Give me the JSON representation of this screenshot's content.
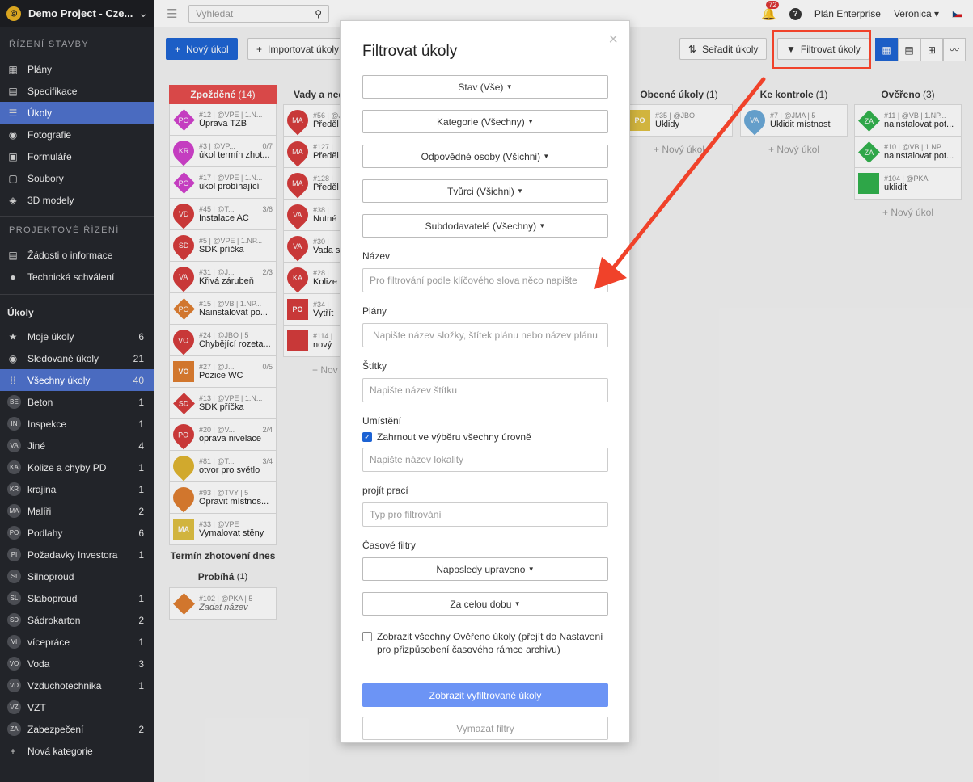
{
  "sidebar": {
    "project": "Demo Project - Cze...",
    "section_build": "ŘÍZENÍ STAVBY",
    "build_items": [
      {
        "label": "Plány",
        "icon": "plans-icon",
        "glyph": "▦"
      },
      {
        "label": "Specifikace",
        "icon": "spec-icon",
        "glyph": "▤"
      },
      {
        "label": "Úkoly",
        "icon": "tasks-icon",
        "glyph": "☰"
      },
      {
        "label": "Fotografie",
        "icon": "camera-icon",
        "glyph": "◉"
      },
      {
        "label": "Formuláře",
        "icon": "forms-icon",
        "glyph": "▣"
      },
      {
        "label": "Soubory",
        "icon": "files-icon",
        "glyph": "▢"
      },
      {
        "label": "3D modely",
        "icon": "cube-icon",
        "glyph": "◈"
      }
    ],
    "section_project": "PROJEKTOVÉ ŘÍZENÍ",
    "project_items": [
      {
        "label": "Žádosti o informace",
        "icon": "info-request-icon",
        "glyph": "▤"
      },
      {
        "label": "Technická schválení",
        "icon": "user-icon",
        "glyph": "●"
      }
    ],
    "tasks_header": "Úkoly",
    "task_filters": [
      {
        "label": "Moje úkoly",
        "count": "6",
        "icon": "star-icon",
        "glyph": "★"
      },
      {
        "label": "Sledované úkoly",
        "count": "21",
        "icon": "eye-icon",
        "glyph": "◉"
      },
      {
        "label": "Všechny úkoly",
        "count": "40",
        "icon": "grid-icon",
        "glyph": "⁞⁞"
      }
    ],
    "categories": [
      {
        "abbr": "BE",
        "label": "Beton",
        "count": "1"
      },
      {
        "abbr": "IN",
        "label": "Inspekce",
        "count": "1"
      },
      {
        "abbr": "VA",
        "label": "Jiné",
        "count": "4"
      },
      {
        "abbr": "KA",
        "label": "Kolize a chyby PD",
        "count": "1"
      },
      {
        "abbr": "KR",
        "label": "krajina",
        "count": "1"
      },
      {
        "abbr": "MA",
        "label": "Malíři",
        "count": "2"
      },
      {
        "abbr": "PO",
        "label": "Podlahy",
        "count": "6"
      },
      {
        "abbr": "PI",
        "label": "Požadavky Investora",
        "count": "1"
      },
      {
        "abbr": "SI",
        "label": "Silnoproud",
        "count": ""
      },
      {
        "abbr": "SL",
        "label": "Slaboproud",
        "count": "1"
      },
      {
        "abbr": "SD",
        "label": "Sádrokarton",
        "count": "2"
      },
      {
        "abbr": "VI",
        "label": "vícepráce",
        "count": "1"
      },
      {
        "abbr": "VO",
        "label": "Voda",
        "count": "3"
      },
      {
        "abbr": "VD",
        "label": "Vzduchotechnika",
        "count": "1"
      },
      {
        "abbr": "VZ",
        "label": "VZT",
        "count": ""
      },
      {
        "abbr": "ZA",
        "label": "Zabezpečení",
        "count": "2"
      }
    ],
    "new_category": "Nová kategorie"
  },
  "topbar": {
    "search_placeholder": "Vyhledat",
    "notifications": "72",
    "plan": "Plán Enterprise",
    "user": "Veronica"
  },
  "toolbar": {
    "new_task": "Nový úkol",
    "import": "Importovat úkoly",
    "sort": "Seřadit úkoly",
    "filter": "Filtrovat úkoly"
  },
  "columns": {
    "delayed": {
      "title": "Zpožděné",
      "count": "(14)"
    },
    "defects": {
      "title": "Vady a nedo"
    },
    "general": {
      "title": "Obecné úkoly",
      "count": "(1)"
    },
    "review": {
      "title": "Ke kontrole",
      "count": "(1)"
    },
    "verified": {
      "title": "Ověřeno",
      "count": "(3)"
    }
  },
  "delayed_cards": [
    {
      "abbr": "PO",
      "meta": "#12 | @VPE | 1.N...",
      "progress": "",
      "name": "Úprava TZB",
      "color": "#d23fce",
      "shape": "dia"
    },
    {
      "abbr": "KR",
      "meta": "#3 | @VP...",
      "progress": "0/7",
      "name": "úkol termín zhot...",
      "color": "#d23fce",
      "shape": "pin"
    },
    {
      "abbr": "PO",
      "meta": "#17 | @VPE | 1.N...",
      "progress": "",
      "name": "úkol probíhající",
      "color": "#d23fce",
      "shape": "dia"
    },
    {
      "abbr": "VD",
      "meta": "#45 | @T...",
      "progress": "3/6",
      "name": "Instalace AC",
      "color": "#d63a3a",
      "shape": "pin"
    },
    {
      "abbr": "SD",
      "meta": "#5 | @VPE | 1.NP...",
      "progress": "",
      "name": "SDK příčka",
      "color": "#d63a3a",
      "shape": "pin"
    },
    {
      "abbr": "VA",
      "meta": "#31 | @J...",
      "progress": "2/3",
      "name": "Křivá zárubeň",
      "color": "#d63a3a",
      "shape": "pin"
    },
    {
      "abbr": "PO",
      "meta": "#15 | @VB | 1.NP...",
      "progress": "",
      "name": "Nainstalovat po...",
      "color": "#e07d2e",
      "shape": "dia"
    },
    {
      "abbr": "VO",
      "meta": "#24 | @JBO | 5",
      "progress": "",
      "name": "Chybějící rozeta...",
      "color": "#d63a3a",
      "shape": "pin"
    },
    {
      "abbr": "VO",
      "meta": "#27 | @J...",
      "progress": "0/5",
      "name": "Pozice WC",
      "color": "#e07d2e",
      "shape": "sq"
    },
    {
      "abbr": "SD",
      "meta": "#13 | @VPE | 1.N...",
      "progress": "",
      "name": "SDK příčka",
      "color": "#d63a3a",
      "shape": "dia"
    },
    {
      "abbr": "PO",
      "meta": "#20 | @V...",
      "progress": "2/4",
      "name": "oprava nivelace",
      "color": "#d63a3a",
      "shape": "pin"
    },
    {
      "abbr": "",
      "meta": "#81 | @T...",
      "progress": "3/4",
      "name": "otvor pro světlo",
      "color": "#e0b52e",
      "shape": "pin"
    },
    {
      "abbr": "",
      "meta": "#93 | @TVY | 5",
      "progress": "",
      "name": "Opravit místnos...",
      "color": "#e07d2e",
      "shape": "pin"
    },
    {
      "abbr": "MA",
      "meta": "#33 | @VPE",
      "progress": "",
      "name": "Vymalovat stěny",
      "color": "#e0c040",
      "shape": "sq"
    }
  ],
  "sub_today": "Termín zhotovení dnes",
  "sub_progress": {
    "title": "Probíhá",
    "count": "(1)"
  },
  "progress_cards": [
    {
      "abbr": "",
      "meta": "#102 | @PKA | 5",
      "progress": "",
      "name": "Zadat název",
      "color": "#e07d2e",
      "shape": "dia"
    }
  ],
  "defect_cards": [
    {
      "abbr": "MA",
      "meta": "#56 | @J",
      "progress": "",
      "name": "Předěl",
      "color": "#d63a3a",
      "shape": "pin"
    },
    {
      "abbr": "MA",
      "meta": "#127 |",
      "progress": "",
      "name": "Předěl",
      "color": "#d63a3a",
      "shape": "pin"
    },
    {
      "abbr": "MA",
      "meta": "#128 |",
      "progress": "",
      "name": "Předěl",
      "color": "#d63a3a",
      "shape": "pin"
    },
    {
      "abbr": "VA",
      "meta": "#38 |",
      "progress": "",
      "name": "Nutné",
      "color": "#d63a3a",
      "shape": "pin"
    },
    {
      "abbr": "VA",
      "meta": "#30 |",
      "progress": "",
      "name": "Vada s",
      "color": "#d63a3a",
      "shape": "pin"
    },
    {
      "abbr": "KA",
      "meta": "#28 |",
      "progress": "",
      "name": "Kolize",
      "color": "#d63a3a",
      "shape": "pin"
    },
    {
      "abbr": "PO",
      "meta": "#34 |",
      "progress": "",
      "name": "Vytřít",
      "color": "#d63a3a",
      "shape": "sq"
    },
    {
      "abbr": "",
      "meta": "#114 |",
      "progress": "",
      "name": "nový",
      "color": "#d63a3a",
      "shape": "sq"
    }
  ],
  "general_cards": [
    {
      "abbr": "PO",
      "meta": "#35 | @JBO",
      "progress": "",
      "name": "Úklidy",
      "color": "#e0c040",
      "shape": "sq"
    }
  ],
  "review_cards": [
    {
      "abbr": "VA",
      "meta": "#7 | @JMA | 5",
      "progress": "",
      "name": "Uklidit místnost",
      "color": "#6aa9d8",
      "shape": "pin"
    }
  ],
  "verified_cards": [
    {
      "abbr": "ZA",
      "meta": "#11 | @VB | 1.NP...",
      "progress": "",
      "name": "nainstalovat pot...",
      "color": "#2fb14b",
      "shape": "dia"
    },
    {
      "abbr": "ZA",
      "meta": "#10 | @VB | 1.NP...",
      "progress": "",
      "name": "nainstalovat pot...",
      "color": "#2fb14b",
      "shape": "dia"
    },
    {
      "abbr": "",
      "meta": "#104 | @PKA",
      "progress": "",
      "name": "uklidit",
      "color": "#2fb14b",
      "shape": "sq"
    }
  ],
  "new_task_link": "+ Nový úkol",
  "new_task_cut": "+ Nov",
  "modal": {
    "title": "Filtrovat úkoly",
    "state": "Stav (Vše)",
    "category": "Kategorie (Všechny)",
    "responsible": "Odpovědné osoby (Všichni)",
    "creators": "Tvůrci (Všichni)",
    "subcontractors": "Subdodavatelé (Všechny)",
    "name_label": "Název",
    "name_placeholder": "Pro filtrování podle klíčového slova něco napište",
    "plans_label": "Plány",
    "plans_placeholder": "Napište název složky, štítek plánu nebo název plánu",
    "tags_label": "Štítky",
    "tags_placeholder": "Napište název štítku",
    "location_label": "Umístění",
    "include_levels": "Zahrnout ve výběru všechny úrovně",
    "location_placeholder": "Napište název lokality",
    "work_label": "projít prací",
    "work_placeholder": "Typ pro filtrování",
    "time_label": "Časové filtry",
    "last_modified": "Naposledy upraveno",
    "all_time": "Za celou dobu",
    "show_verified": "Zobrazit všechny Ověřeno úkoly (přejít do Nastavení pro přizpůsobení časového rámce archivu)",
    "submit": "Zobrazit vyfiltrované úkoly",
    "clear": "Vymazat filtry"
  }
}
